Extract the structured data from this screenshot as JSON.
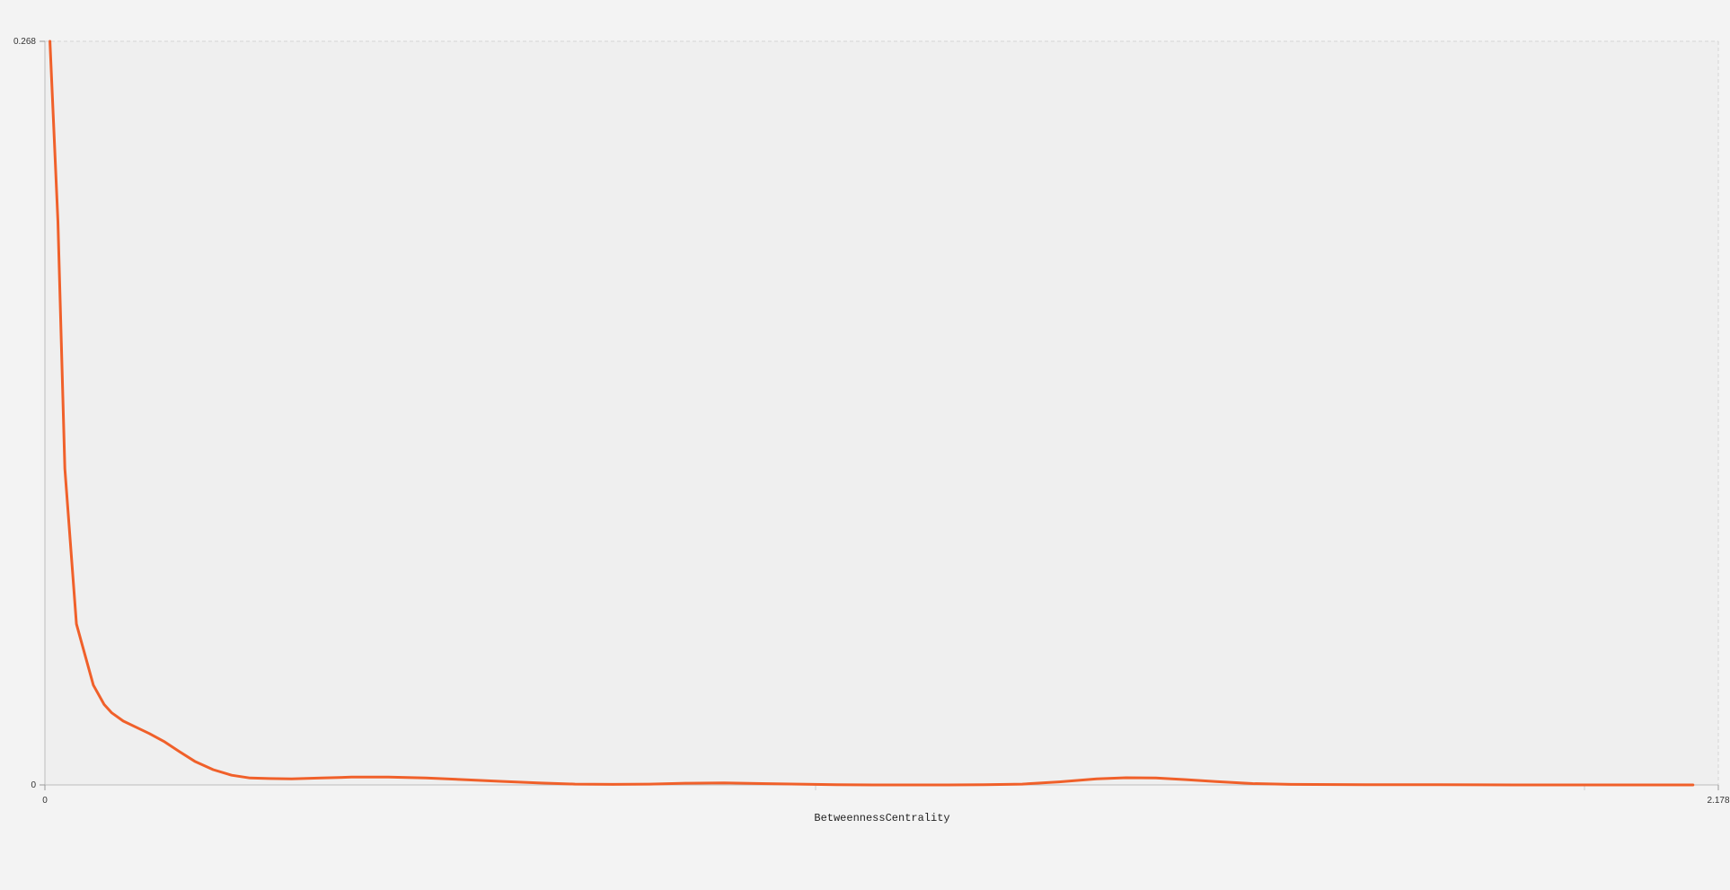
{
  "chart_data": {
    "type": "line",
    "xlabel": "BetweennessCentrality",
    "ylabel": "",
    "xlim": [
      0,
      2.178
    ],
    "ylim": [
      0,
      0.268
    ],
    "x_tick_labels": [
      "0",
      "2.178"
    ],
    "y_tick_labels": [
      "0",
      "0.268"
    ],
    "grid": true,
    "legend": "none",
    "series": [
      {
        "color": "#f0602a",
        "points": [
          [
            0.0065,
            0.268
          ],
          [
            0.017,
            0.203
          ],
          [
            0.026,
            0.114
          ],
          [
            0.041,
            0.058
          ],
          [
            0.063,
            0.036
          ],
          [
            0.077,
            0.029
          ],
          [
            0.087,
            0.026
          ],
          [
            0.102,
            0.023
          ],
          [
            0.121,
            0.0205
          ],
          [
            0.136,
            0.0185
          ],
          [
            0.156,
            0.0155
          ],
          [
            0.175,
            0.012
          ],
          [
            0.195,
            0.0085
          ],
          [
            0.219,
            0.0055
          ],
          [
            0.243,
            0.0035
          ],
          [
            0.267,
            0.0025
          ],
          [
            0.292,
            0.0023
          ],
          [
            0.321,
            0.0022
          ],
          [
            0.36,
            0.0025
          ],
          [
            0.399,
            0.0028
          ],
          [
            0.447,
            0.0028
          ],
          [
            0.496,
            0.0025
          ],
          [
            0.545,
            0.0019
          ],
          [
            0.593,
            0.0013
          ],
          [
            0.642,
            0.0007
          ],
          [
            0.69,
            0.0003
          ],
          [
            0.739,
            0.0002
          ],
          [
            0.787,
            0.0003
          ],
          [
            0.836,
            0.0006
          ],
          [
            0.884,
            0.0007
          ],
          [
            0.933,
            0.0005
          ],
          [
            0.981,
            0.0003
          ],
          [
            1.03,
            0.0001
          ],
          [
            1.078,
            0.0
          ],
          [
            1.175,
            0.0
          ],
          [
            1.223,
            0.0001
          ],
          [
            1.272,
            0.0003
          ],
          [
            1.32,
            0.0011
          ],
          [
            1.369,
            0.0022
          ],
          [
            1.407,
            0.0026
          ],
          [
            1.446,
            0.0025
          ],
          [
            1.485,
            0.0019
          ],
          [
            1.524,
            0.0012
          ],
          [
            1.572,
            0.0005
          ],
          [
            1.621,
            0.0002
          ],
          [
            1.718,
            0.0001
          ],
          [
            1.815,
            0.0001
          ],
          [
            1.912,
            0.0
          ],
          [
            2.009,
            0.0
          ],
          [
            2.106,
            0.0
          ],
          [
            2.145,
            0.0
          ]
        ]
      }
    ]
  }
}
